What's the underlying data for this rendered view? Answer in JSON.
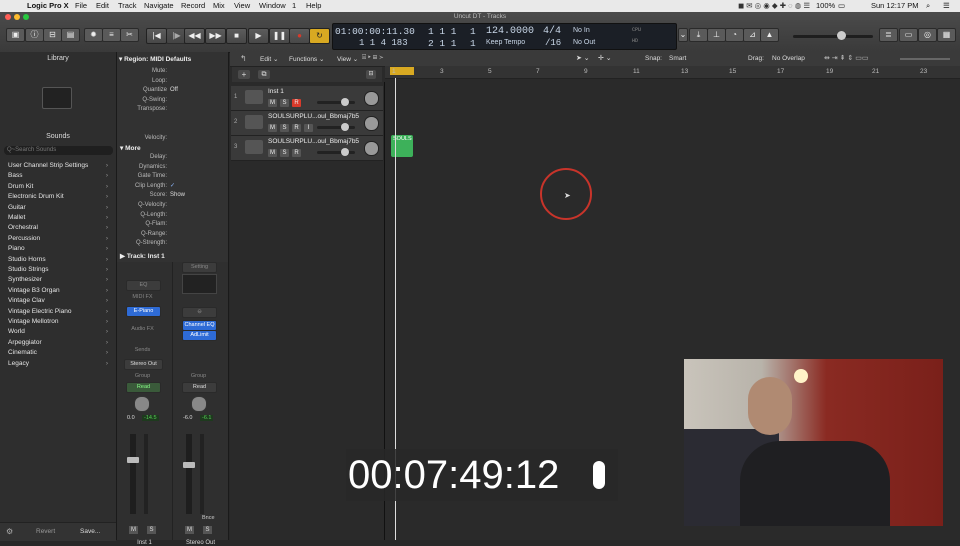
{
  "menubar": {
    "app_name": "Logic Pro X",
    "items": [
      "File",
      "Edit",
      "Track",
      "Navigate",
      "Record",
      "Mix",
      "View",
      "Window",
      "1",
      "Help"
    ],
    "battery": "100%",
    "clock": "Sun 12:17 PM"
  },
  "window_title": "Uncut DT - Tracks",
  "lcd": {
    "time": "01:00:00:11.30",
    "bars": "1  1  4  183",
    "bar_pos": "1  1  1",
    "bar_pos2": "2  1  1",
    "bar_sub": "1",
    "bar_sub2": "1",
    "tempo": "124.0000",
    "tempo_label": "Keep Tempo",
    "sig": "4/4",
    "div": "/16",
    "in": "No In",
    "out": "No Out",
    "cpu": "CPU",
    "hd": "HD"
  },
  "library": {
    "title": "Library",
    "sounds_label": "Sounds",
    "search_placeholder": "Q~Search Sounds",
    "categories": [
      "User Channel Strip Settings",
      "Bass",
      "Drum Kit",
      "Electronic Drum Kit",
      "Guitar",
      "Mallet",
      "Orchestral",
      "Percussion",
      "Piano",
      "Studio Horns",
      "Studio Strings",
      "Synthesizer",
      "Vintage B3 Organ",
      "Vintage Clav",
      "Vintage Electric Piano",
      "Vintage Mellotron",
      "World",
      "Arpeggiator",
      "Cinematic",
      "Legacy"
    ],
    "revert": "Revert",
    "save": "Save..."
  },
  "inspector": {
    "region_header": "Region:  MIDI Defaults",
    "rows": [
      "Mute:",
      "Loop:",
      "Quantize",
      "Q-Swing:",
      "Transpose:",
      "",
      "",
      "Velocity:"
    ],
    "quantize_value": "Off",
    "more": "More",
    "more_rows": [
      "Delay:",
      "Dynamics:",
      "Gate Time:",
      "Clip Length:",
      "Score:",
      "Q-Velocity:",
      "Q-Length:",
      "Q-Flam:",
      "Q-Range:",
      "Q-Strength:"
    ],
    "score_value": "Show",
    "clip_value": "✓",
    "track_header": "Track:  Inst 1",
    "strip1": {
      "eq": "EQ",
      "midi_fx": "MIDI FX",
      "instrument": "E-Piano",
      "audio_fx": "Audio FX",
      "sends": "Sends",
      "output": "Stereo Out",
      "group": "Group",
      "read": "Read",
      "vol": "0.0",
      "pan": "-14.5",
      "name": "Inst 1"
    },
    "strip2": {
      "setting": "Setting",
      "eq": "Channel EQ",
      "fx": "AdLimit",
      "group": "Group",
      "read": "Read",
      "vol": "-6.0",
      "pan": "-6.1",
      "bnce": "Bnce",
      "name": "Stereo Out"
    },
    "m": "M",
    "s": "S"
  },
  "tracks_toolbar": {
    "edit": "Edit",
    "functions": "Functions",
    "view": "View",
    "snap_label": "Snap:",
    "snap_value": "Smart",
    "drag_label": "Drag:",
    "drag_value": "No Overlap"
  },
  "ruler": [
    "1",
    "3",
    "5",
    "7",
    "9",
    "11",
    "13",
    "15",
    "17",
    "19",
    "21",
    "23"
  ],
  "tracks": [
    {
      "num": "1",
      "name": "Inst 1",
      "r": "R"
    },
    {
      "num": "2",
      "name": "SOULSURPLU...oul_Bbmaj7b5",
      "r": "R",
      "i": "I"
    },
    {
      "num": "3",
      "name": "SOULSURPLU...oul_Bbmaj7b5",
      "r": "R"
    }
  ],
  "region_label": "SOULS",
  "timer": "00:07:49:12",
  "colors": {
    "accent": "#f4c430",
    "region": "#3db15a",
    "record": "#d83a2b",
    "instrument": "#2e6bd6"
  }
}
